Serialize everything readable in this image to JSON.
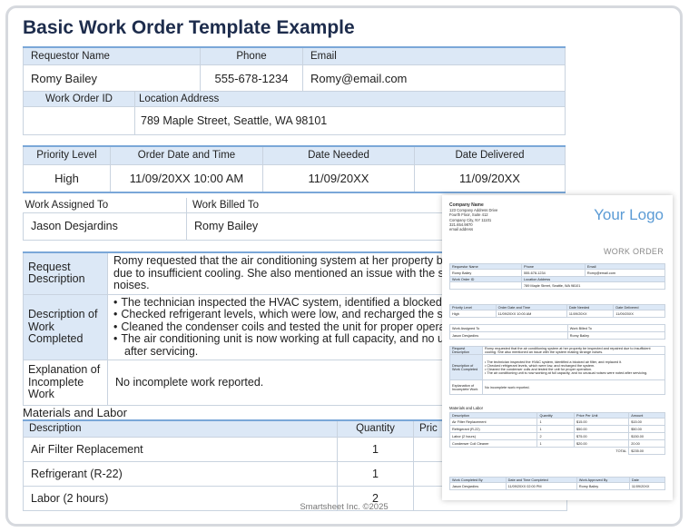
{
  "title": "Basic Work Order Template Example",
  "requestor": {
    "name_label": "Requestor Name",
    "phone_label": "Phone",
    "email_label": "Email",
    "name": "Romy Bailey",
    "phone": "555-678-1234",
    "email": "Romy@email.com",
    "wo_label": "Work Order ID",
    "loc_label": "Location Address",
    "wo_id": "",
    "location": "789 Maple Street, Seattle, WA 98101"
  },
  "order": {
    "priority_label": "Priority Level",
    "date_time_label": "Order Date and Time",
    "needed_label": "Date Needed",
    "delivered_label": "Date Delivered",
    "priority": "High",
    "date_time": "11/09/20XX 10:00 AM",
    "needed": "11/09/20XX",
    "delivered": "11/09/20XX"
  },
  "assignment": {
    "assigned_label": "Work Assigned To",
    "billed_label": "Work Billed To",
    "assigned": "Jason Desjardins",
    "billed": "Romy Bailey"
  },
  "details": {
    "request_label": "Request Description",
    "request_lines": [
      "Romy requested that the air conditioning system at her property be i",
      "due to insufficient cooling. She also mentioned an issue with the syste",
      "noises."
    ],
    "completed_label": "Description of Work Completed",
    "completed_lines": [
      "The technician inspected the HVAC system, identified a blocked ai",
      "Checked refrigerant levels, which were low, and recharged the sys",
      "Cleaned the condenser coils and tested the unit for proper operati",
      "The air conditioning unit is now working at full capacity, and no unu"
    ],
    "completed_cont": "after servicing.",
    "incomplete_label": "Explanation of Incomplete Work",
    "incomplete": "No incomplete work reported."
  },
  "materials": {
    "section_title": "Materials and Labor",
    "desc_label": "Description",
    "qty_label": "Quantity",
    "price_label": "Pric",
    "rows": [
      {
        "desc": "Air Filter Replacement",
        "qty": "1"
      },
      {
        "desc": "Refrigerant (R-22)",
        "qty": "1"
      },
      {
        "desc": "Labor (2 hours)",
        "qty": "2"
      }
    ]
  },
  "footer": "Smartsheet Inc. ©2025",
  "preview": {
    "company_name": "Company Name",
    "company_lines": [
      "123 Company Address Drive",
      "Fourth Floor, Suite 412",
      "Company City, NY 11101",
      "321.654.9870",
      "email address"
    ],
    "logo": "Your Logo",
    "heading": "WORK ORDER",
    "request_text": "Romy requested that the air conditioning system at her property be inspected and repaired due to insufficient cooling. She also mentioned an issue with the system making strange noises.",
    "completed_lines": [
      "• The technician inspected the HVAC system, identified a blocked air filter, and replaced it.",
      "• Checked refrigerant levels, which were low, and recharged the system.",
      "• Cleaned the condenser coils and tested the unit for proper operation.",
      "• The air conditioning unit is now working at full capacity, and no unusual noises were noted after servicing."
    ],
    "mat_headers": [
      "Description",
      "Quantity",
      "Price Per Unit",
      "Amount"
    ],
    "mat_rows": [
      [
        "Air Filter Replacement",
        "1",
        "$15.00",
        "$15.00"
      ],
      [
        "Refrigerant (R-22)",
        "1",
        "$50.00",
        "$50.00"
      ],
      [
        "Labor (2 hours)",
        "2",
        "$75.00",
        "$150.00"
      ],
      [
        "Condenser Coil Cleaner",
        "1",
        "$20.00",
        "20.00"
      ]
    ],
    "total_label": "TOTAL",
    "total": "$235.00",
    "sign_headers": [
      "Work Completed By",
      "Date and Time Completed",
      "Work Approved By",
      "Date"
    ],
    "sign_values": [
      "Jason Desjardins",
      "11/09/20XX 02:00 PM",
      "Romy Bailey",
      "11/09/20XX"
    ]
  }
}
